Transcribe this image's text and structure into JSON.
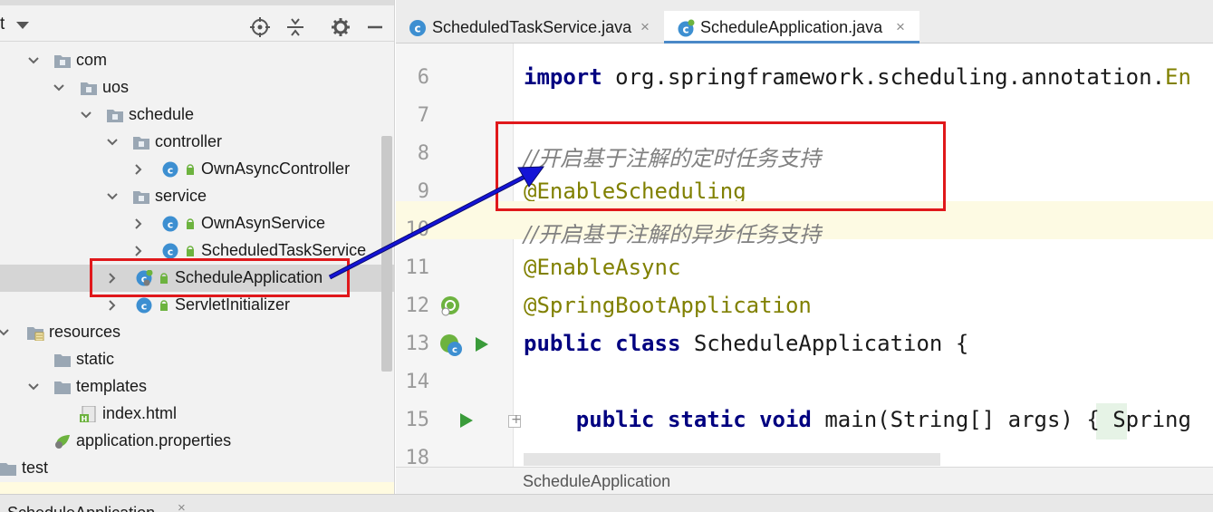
{
  "project_panel": {
    "title_fragment": "t",
    "tree": [
      {
        "label": "com",
        "type": "package",
        "expanded": true
      },
      {
        "label": "uos",
        "type": "package",
        "expanded": true
      },
      {
        "label": "schedule",
        "type": "package",
        "expanded": true
      },
      {
        "label": "controller",
        "type": "package",
        "expanded": true
      },
      {
        "label": "OwnAsyncController",
        "type": "class",
        "expanded": false
      },
      {
        "label": "service",
        "type": "package",
        "expanded": true
      },
      {
        "label": "OwnAsynService",
        "type": "class",
        "expanded": false
      },
      {
        "label": "ScheduledTaskService",
        "type": "class",
        "expanded": false
      },
      {
        "label": "ScheduleApplication",
        "type": "spring-class",
        "expanded": false,
        "selected": true
      },
      {
        "label": "ServletInitializer",
        "type": "class",
        "expanded": false
      },
      {
        "label": "resources",
        "type": "resources-folder",
        "expanded": true
      },
      {
        "label": "static",
        "type": "folder"
      },
      {
        "label": "templates",
        "type": "folder",
        "expanded": true
      },
      {
        "label": "index.html",
        "type": "html-file"
      },
      {
        "label": "application.properties",
        "type": "properties-file"
      },
      {
        "label": "test",
        "type": "folder"
      }
    ]
  },
  "tabs": [
    {
      "label": "ScheduledTaskService.java",
      "close": "×",
      "active": false
    },
    {
      "label": "ScheduleApplication.java",
      "close": "×",
      "active": true
    }
  ],
  "editor": {
    "lines": [
      {
        "number": "6",
        "parts": [
          {
            "t": "import",
            "c": "kw"
          },
          {
            "t": " org.springframework.scheduling.annotation.",
            "c": "pl"
          },
          {
            "t": "En",
            "c": "ann"
          }
        ]
      },
      {
        "number": "7",
        "parts": []
      },
      {
        "number": "8",
        "parts": [
          {
            "t": "//开启基于注解的定时任务支持",
            "c": "cmt"
          }
        ]
      },
      {
        "number": "9",
        "parts": [
          {
            "t": "@EnableScheduling",
            "c": "ann"
          }
        ]
      },
      {
        "number": "10",
        "parts": [
          {
            "t": "//开启基于注解的异步任务支持",
            "c": "cmt"
          }
        ]
      },
      {
        "number": "11",
        "parts": [
          {
            "t": "@EnableAsync",
            "c": "ann"
          }
        ]
      },
      {
        "number": "12",
        "parts": [
          {
            "t": "@SpringBootApplication",
            "c": "ann"
          }
        ]
      },
      {
        "number": "13",
        "parts": [
          {
            "t": "public class",
            "c": "kw"
          },
          {
            "t": " ScheduleApplication {",
            "c": "pl"
          }
        ]
      },
      {
        "number": "14",
        "parts": []
      },
      {
        "number": "15",
        "parts": [
          {
            "t": "    ",
            "c": "pl"
          },
          {
            "t": "public static void",
            "c": "kw"
          },
          {
            "t": " main(String[] args) ",
            "c": "pl"
          },
          {
            "t": "{",
            "c": "pl"
          },
          {
            "t": " Spring",
            "c": "pl"
          }
        ]
      },
      {
        "number": "18",
        "parts": []
      }
    ],
    "breadcrumb": "ScheduleApplication"
  },
  "run_config": {
    "label": "ScheduleApplication",
    "close": "×"
  },
  "colors": {
    "annotation_red": "#e0181b",
    "arrow_blue": "#1414d6",
    "keyword": "#000080",
    "annotation": "#808000",
    "comment": "#808080",
    "spring_green": "#6db33f",
    "class_blue": "#3d8fd1"
  }
}
